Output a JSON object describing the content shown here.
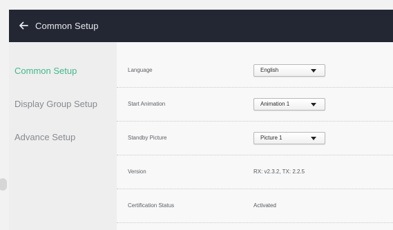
{
  "header": {
    "back_icon": "arrow-left-icon",
    "title": "Common Setup"
  },
  "sidebar": {
    "items": [
      {
        "label": "Common Setup",
        "active": true
      },
      {
        "label": "Display Group Setup",
        "active": false
      },
      {
        "label": "Advance Setup",
        "active": false
      }
    ]
  },
  "settings": {
    "language": {
      "label": "Language",
      "value": "English"
    },
    "start_animation": {
      "label": "Start Animation",
      "value": "Animation 1"
    },
    "standby_picture": {
      "label": "Standby Picture",
      "value": "Picture 1"
    },
    "version": {
      "label": "Version",
      "value": "RX: v2.3.2, TX: 2.2.5"
    },
    "certification_status": {
      "label": "Certification Status",
      "value": "Activated"
    }
  },
  "colors": {
    "header_bg": "#232733",
    "accent": "#42b88d",
    "sidebar_bg": "#eeeeee",
    "content_bg": "#f8f8f8"
  }
}
